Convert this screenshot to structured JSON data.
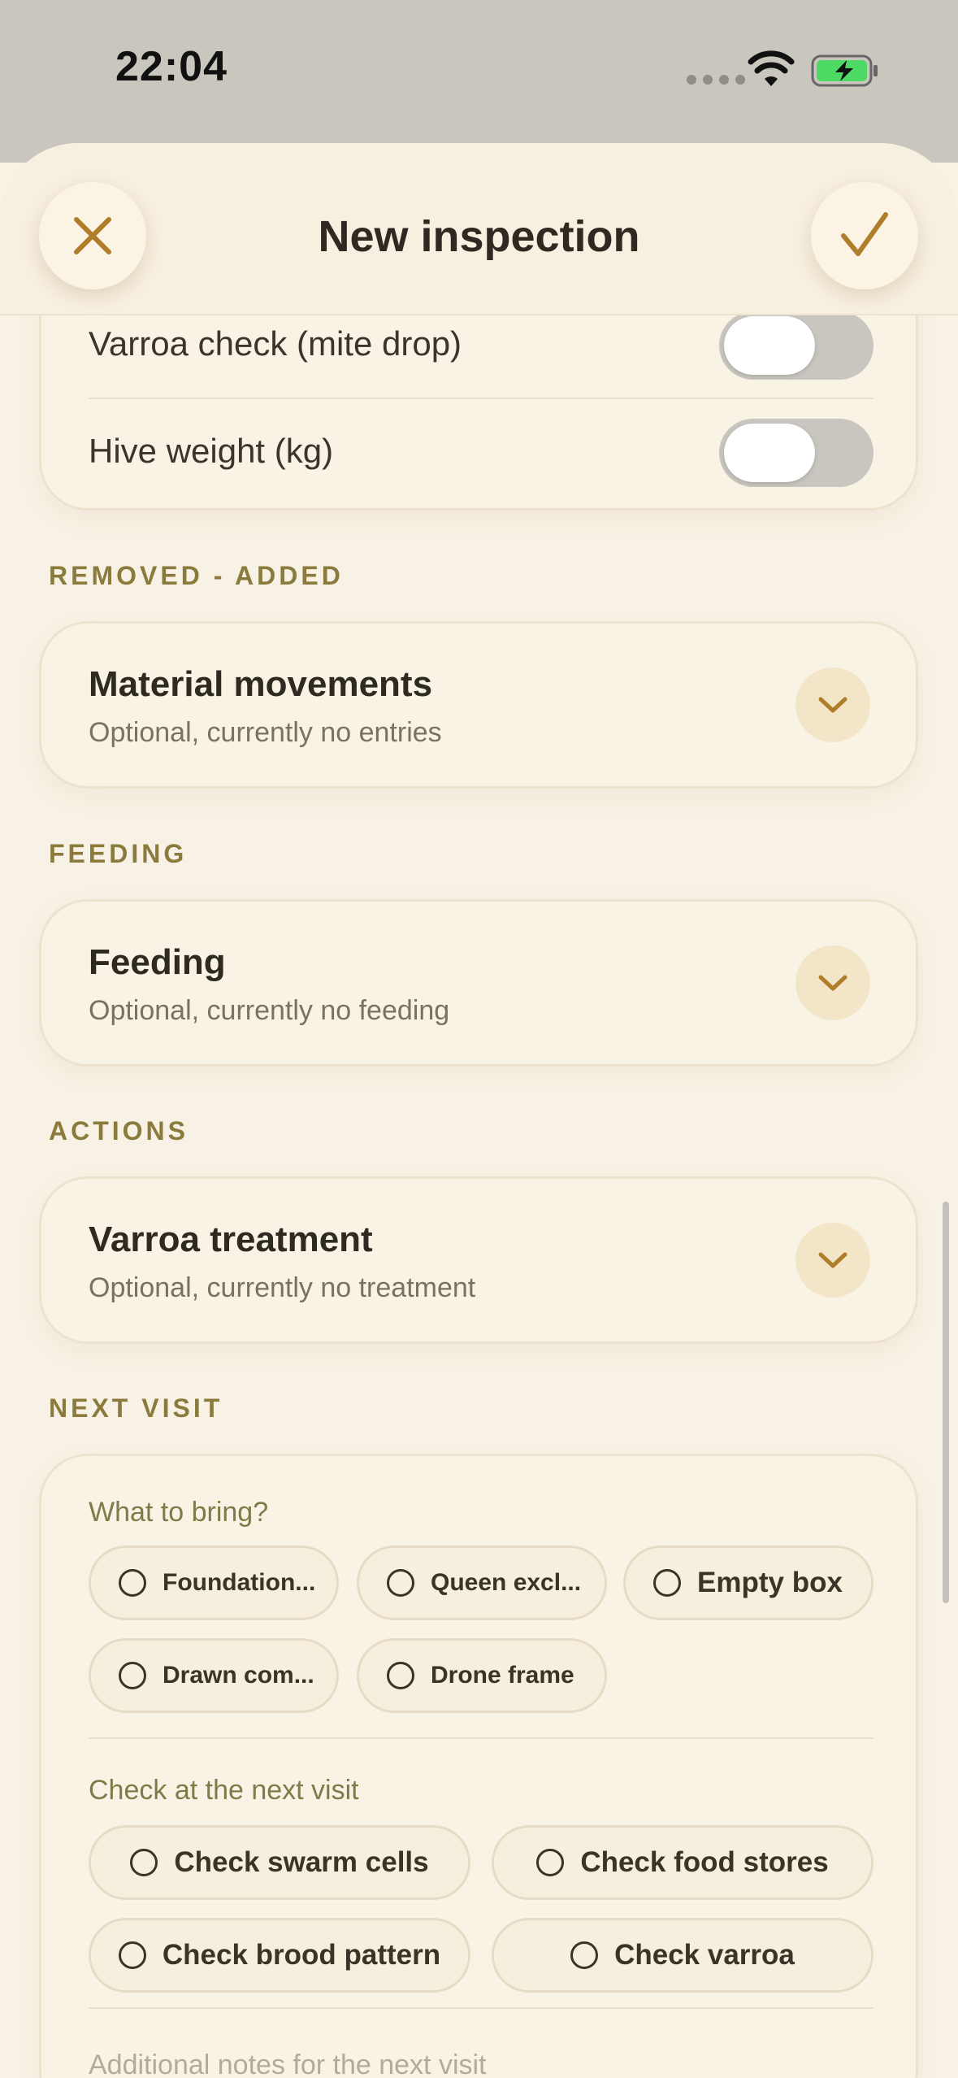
{
  "status_bar": {
    "time": "22:04"
  },
  "header": {
    "title": "New inspection"
  },
  "measurements": {
    "rows": [
      {
        "label": "Varroa check (mite drop)",
        "enabled": false
      },
      {
        "label": "Hive weight (kg)",
        "enabled": false
      }
    ]
  },
  "removed_added": {
    "section": "REMOVED - ADDED",
    "title": "Material movements",
    "subtitle": "Optional, currently no entries"
  },
  "feeding": {
    "section": "FEEDING",
    "title": "Feeding",
    "subtitle": "Optional, currently no feeding"
  },
  "actions": {
    "section": "ACTIONS",
    "title": "Varroa treatment",
    "subtitle": "Optional, currently no treatment"
  },
  "next_visit": {
    "section": "NEXT VISIT",
    "bring_heading": "What to bring?",
    "bring_options": [
      "Foundation...",
      "Queen excl...",
      "Empty box",
      "Drawn com...",
      "Drone frame"
    ],
    "check_heading": "Check at the next visit",
    "check_options": [
      "Check swarm cells",
      "Check food stores",
      "Check brood pattern",
      "Check varroa"
    ],
    "notes_placeholder": "Additional notes for the next visit"
  },
  "colors": {
    "accent": "#b07d2a",
    "background": "#f8f1e4",
    "section_label": "#8a7b3d"
  }
}
